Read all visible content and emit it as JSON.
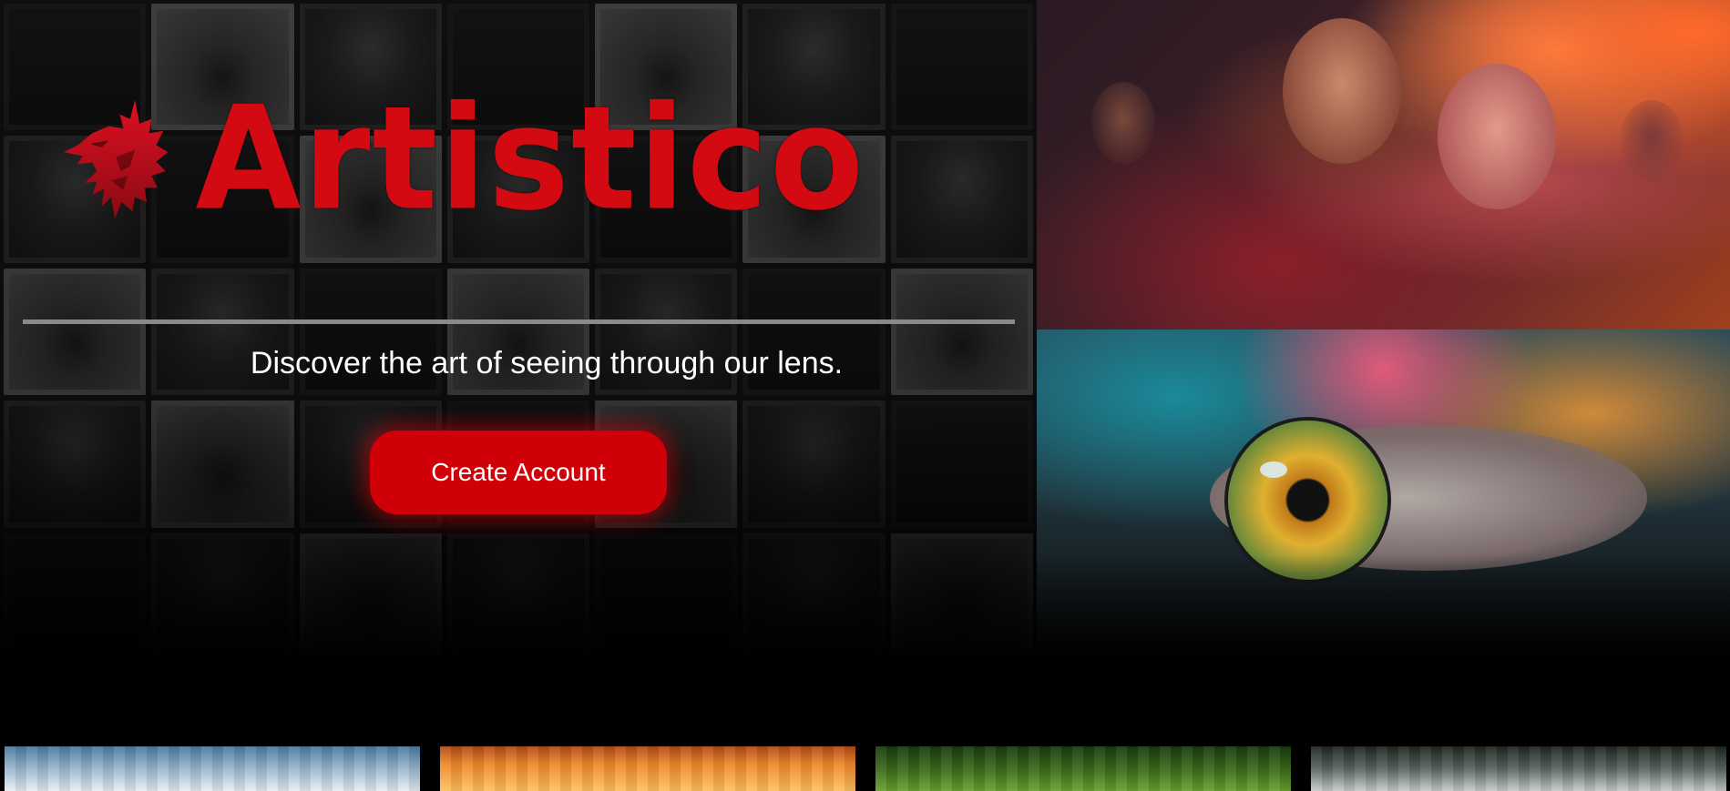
{
  "brand": {
    "name": "Artistico",
    "logo_icon": "wolf-icon",
    "color": "#d40a12"
  },
  "hero": {
    "tagline": "Discover the art of seeing through our lens.",
    "cta_label": "Create Account",
    "cta_color": "#d00008"
  },
  "gallery": {
    "images": [
      "photo-wall-image",
      "party-photo",
      "eye-photo"
    ]
  },
  "thumbnails": [
    "sky-thumbnail",
    "sunset-thumbnail",
    "forest-thumbnail",
    "misty-forest-thumbnail"
  ]
}
